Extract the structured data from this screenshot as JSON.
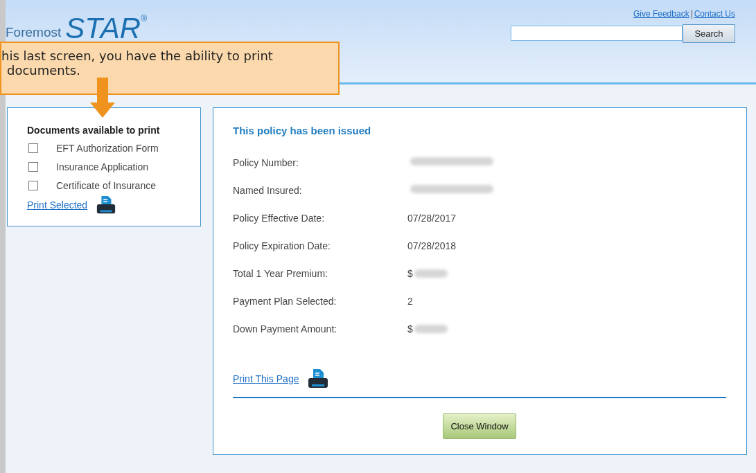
{
  "header": {
    "logo_small": "Foremost",
    "logo_big": "STAR",
    "logo_mark": "®",
    "links": [
      "Give Feedback",
      "Contact Us"
    ],
    "search": {
      "button": "Search"
    }
  },
  "callout": {
    "lines": [
      "his last screen, you have the ability to print",
      "documents."
    ]
  },
  "documents": {
    "title": "Documents available to print",
    "items": [
      {
        "label": "EFT Authorization Form",
        "checked": false
      },
      {
        "label": "Insurance Application",
        "checked": false
      },
      {
        "label": "Certificate of Insurance",
        "checked": false
      }
    ],
    "print_link": "Print Selected"
  },
  "policy": {
    "title": "This policy has been issued",
    "rows": [
      {
        "label": "Policy Number:",
        "value": "",
        "redacted": true
      },
      {
        "label": "Named Insured:",
        "value": "",
        "redacted": true
      },
      {
        "label": "Policy Effective Date:",
        "value": "07/28/2017",
        "redacted": false
      },
      {
        "label": "Policy Expiration Date:",
        "value": "07/28/2018",
        "redacted": false
      },
      {
        "label": "Total 1 Year Premium:",
        "value": "$",
        "redacted": true
      },
      {
        "label": "Payment Plan Selected:",
        "value": "2",
        "redacted": false
      },
      {
        "label": "Down Payment Amount:",
        "value": "$",
        "redacted": true
      }
    ],
    "print_link": "Print This Page",
    "close_button": "Close Window"
  }
}
